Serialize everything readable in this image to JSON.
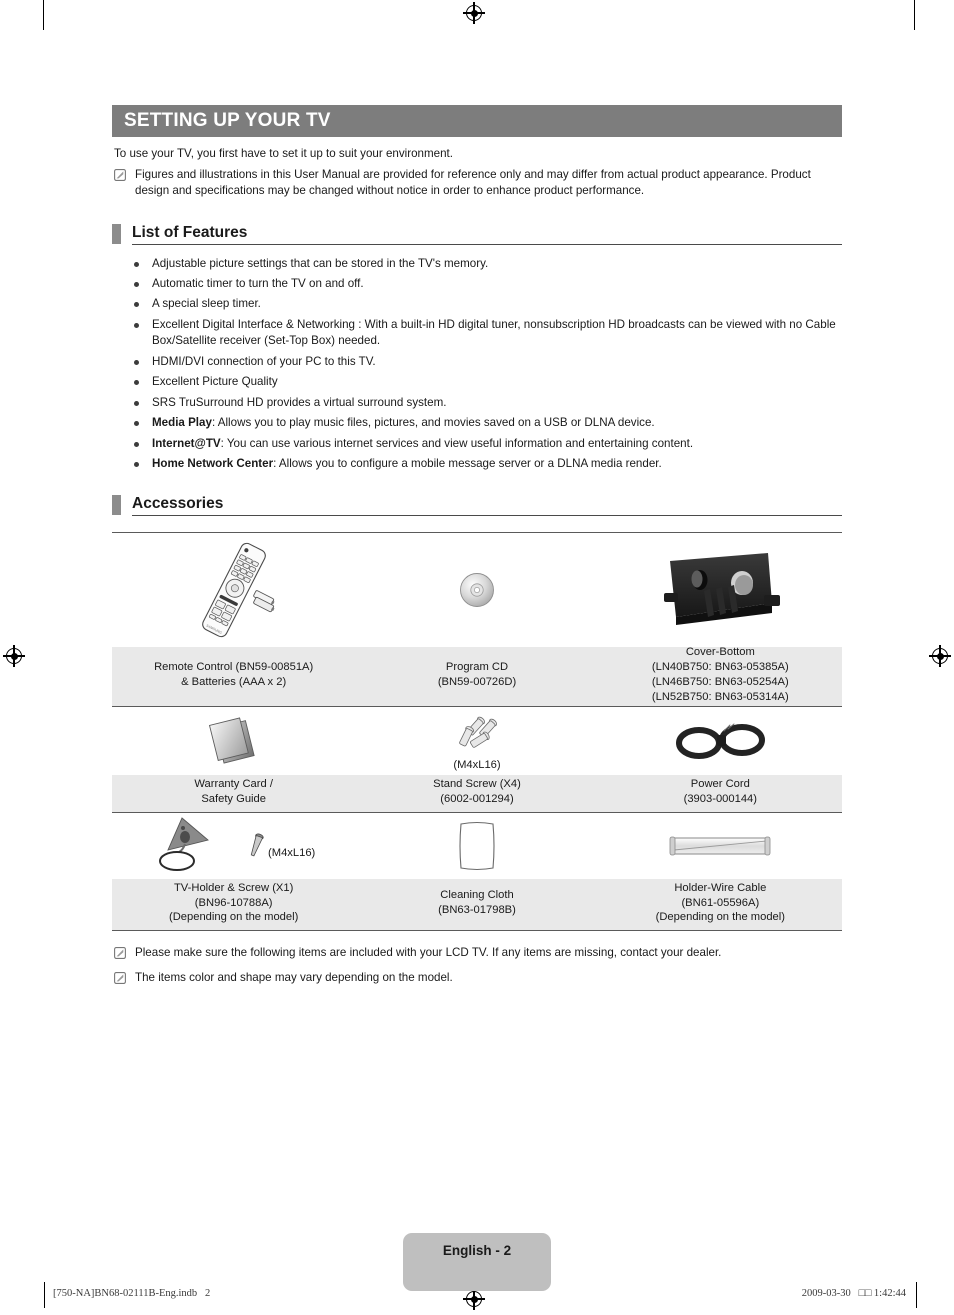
{
  "chapter": {
    "title": "SETTING UP YOUR TV",
    "intro": "To use your TV, you first have to set it up to suit your environment.",
    "notes": [
      "Figures and illustrations in this User Manual are provided for reference only and may differ from actual product appearance. Product design and specifications may be changed without notice in order to enhance product performance."
    ]
  },
  "features_section": {
    "heading": "List of Features",
    "items": [
      {
        "bold": "",
        "text": "Adjustable picture settings that can be stored in the TV's memory."
      },
      {
        "bold": "",
        "text": "Automatic timer to turn the TV on and off."
      },
      {
        "bold": "",
        "text": "A special sleep timer."
      },
      {
        "bold": "",
        "text": "Excellent Digital Interface & Networking : With a built-in HD digital tuner, nonsubscription HD broadcasts can be viewed with no Cable Box/Satellite receiver (Set-Top Box) needed."
      },
      {
        "bold": "",
        "text": "HDMI/DVI connection of your PC to this TV."
      },
      {
        "bold": "",
        "text": "Excellent Picture Quality"
      },
      {
        "bold": "",
        "text": "SRS TruSurround HD provides a virtual surround system."
      },
      {
        "bold": "Media Play",
        "text": ": Allows you to play music files, pictures, and movies saved on a USB or DLNA device."
      },
      {
        "bold": "Internet@TV",
        "text": ": You can use various internet services and view useful information and entertaining content."
      },
      {
        "bold": "Home Network Center",
        "text": ": Allows you to configure a mobile message server or a DLNA media render."
      }
    ]
  },
  "accessories_section": {
    "heading": "Accessories",
    "rows": [
      {
        "cells": [
          {
            "icon": "remote-control-icon",
            "caption": "Remote Control (BN59-00851A)\n& Batteries (AAA x 2)",
            "sub": ""
          },
          {
            "icon": "program-cd-icon",
            "caption": "Program CD\n(BN59-00726D)",
            "sub": ""
          },
          {
            "icon": "cover-bottom-icon",
            "caption": "Cover-Bottom\n(LN40B750: BN63-05385A)\n(LN46B750: BN63-05254A)\n(LN52B750: BN63-05314A)",
            "sub": ""
          }
        ]
      },
      {
        "cells": [
          {
            "icon": "warranty-card-icon",
            "caption": "Warranty Card /\nSafety Guide",
            "sub": ""
          },
          {
            "icon": "stand-screw-icon",
            "caption": "Stand Screw (X4)\n(6002-001294)",
            "sub": "(M4xL16)"
          },
          {
            "icon": "power-cord-icon",
            "caption": "Power Cord\n(3903-000144)",
            "sub": ""
          }
        ]
      },
      {
        "cells": [
          {
            "icon": "tv-holder-screw-icon",
            "caption": "TV-Holder & Screw (X1)\n(BN96-10788A)\n(Depending on the model)",
            "sub": "(M4xL16)"
          },
          {
            "icon": "cleaning-cloth-icon",
            "caption": "Cleaning Cloth\n(BN63-01798B)",
            "sub": ""
          },
          {
            "icon": "holder-wire-cable-icon",
            "caption": "Holder-Wire Cable\n(BN61-05596A)\n(Depending on the model)",
            "sub": ""
          }
        ]
      }
    ],
    "notes": [
      "Please make sure the following items are included with your LCD TV. If any items are missing, contact your dealer.",
      "The items color and shape may vary depending on the model."
    ]
  },
  "page_footer": {
    "page_label": "English - 2",
    "print_file": "[750-NA]BN68-02111B-Eng.indb   2",
    "print_timestamp": "2009-03-30   □□ 1:42:44"
  },
  "colors": {
    "chapter_bar": "#7d7d7d",
    "section_marker": "#8c8c8c",
    "caption_row_bg": "#e9e9e9",
    "page_tab_bg": "#bfbfbf",
    "rule": "#5a5a5a"
  }
}
